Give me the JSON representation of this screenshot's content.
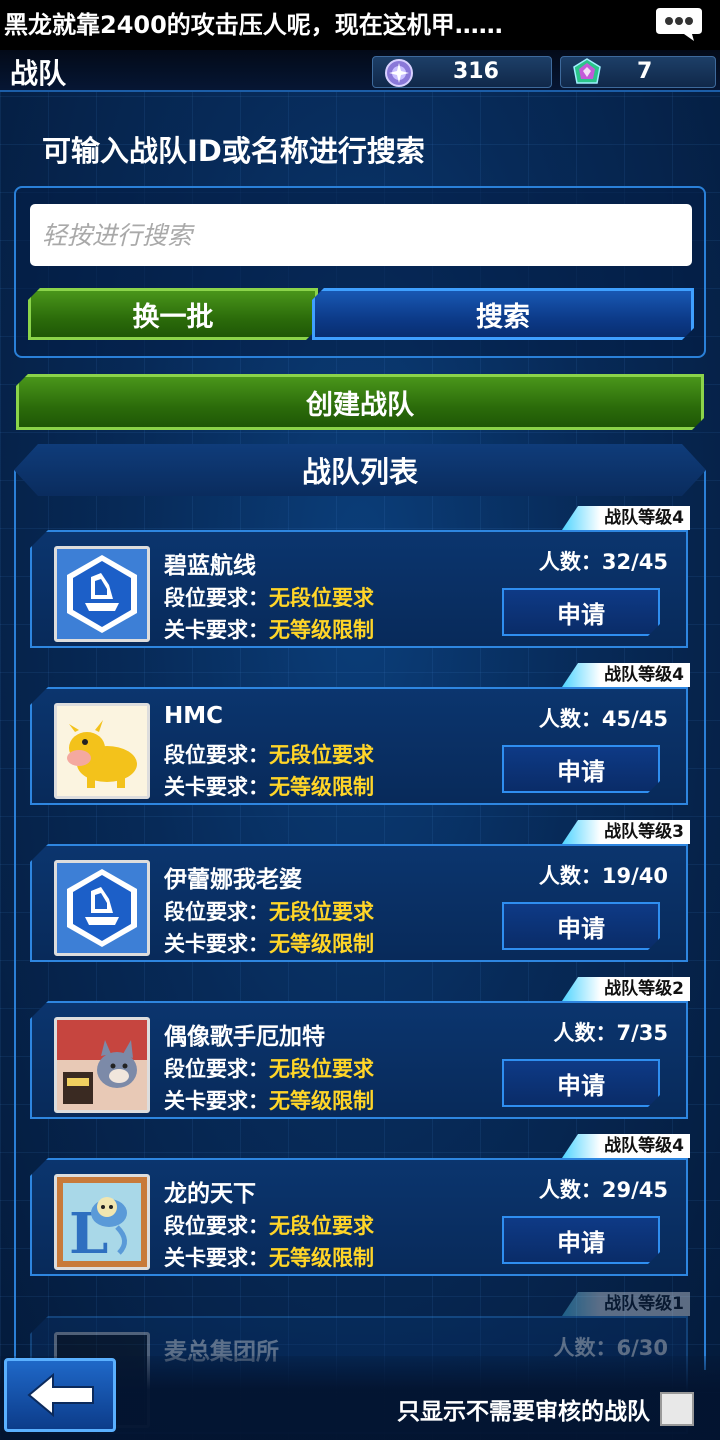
{
  "ticker": {
    "text": "黑龙就靠2400的攻击压人呢，现在这机甲……"
  },
  "header": {
    "title": "战队"
  },
  "currency": [
    {
      "icon": "purple-orb-icon",
      "value": "316"
    },
    {
      "icon": "crystal-icon",
      "value": "7"
    }
  ],
  "search": {
    "hint": "可输入战队ID或名称进行搜索",
    "placeholder": "轻按进行搜索",
    "refresh_label": "换一批",
    "search_label": "搜索"
  },
  "create_label": "创建战队",
  "list_title": "战队列表",
  "teams": [
    {
      "level": "战队等级4",
      "name": "碧蓝航线",
      "members": "人数：32/45",
      "rank_label": "段位要求：",
      "rank_value": "无段位要求",
      "stage_label": "关卡要求：",
      "stage_value": "无等级限制",
      "apply": "申请",
      "avatar": "blue-shield-emblem"
    },
    {
      "level": "战队等级4",
      "name": "HMC",
      "members": "人数：45/45",
      "rank_label": "段位要求：",
      "rank_value": "无段位要求",
      "stage_label": "关卡要求：",
      "stage_value": "无等级限制",
      "apply": "申请",
      "avatar": "yellow-cow"
    },
    {
      "level": "战队等级3",
      "name": "伊蕾娜我老婆",
      "members": "人数：19/40",
      "rank_label": "段位要求：",
      "rank_value": "无段位要求",
      "stage_label": "关卡要求：",
      "stage_value": "无等级限制",
      "apply": "申请",
      "avatar": "blue-shield-emblem"
    },
    {
      "level": "战队等级2",
      "name": "偶像歌手厄加特",
      "members": "人数：7/35",
      "rank_label": "段位要求：",
      "rank_value": "无段位要求",
      "stage_label": "关卡要求：",
      "stage_value": "无等级限制",
      "apply": "申请",
      "avatar": "cartoon-cat"
    },
    {
      "level": "战队等级4",
      "name": "龙的天下",
      "members": "人数：29/45",
      "rank_label": "段位要求：",
      "rank_value": "无段位要求",
      "stage_label": "关卡要求：",
      "stage_value": "无等级限制",
      "apply": "申请",
      "avatar": "blue-dragon-card"
    },
    {
      "level": "战队等级1",
      "name": "麦总集团所",
      "members": "人数：6/30"
    }
  ],
  "filter_label": "只显示不需要审核的战队"
}
